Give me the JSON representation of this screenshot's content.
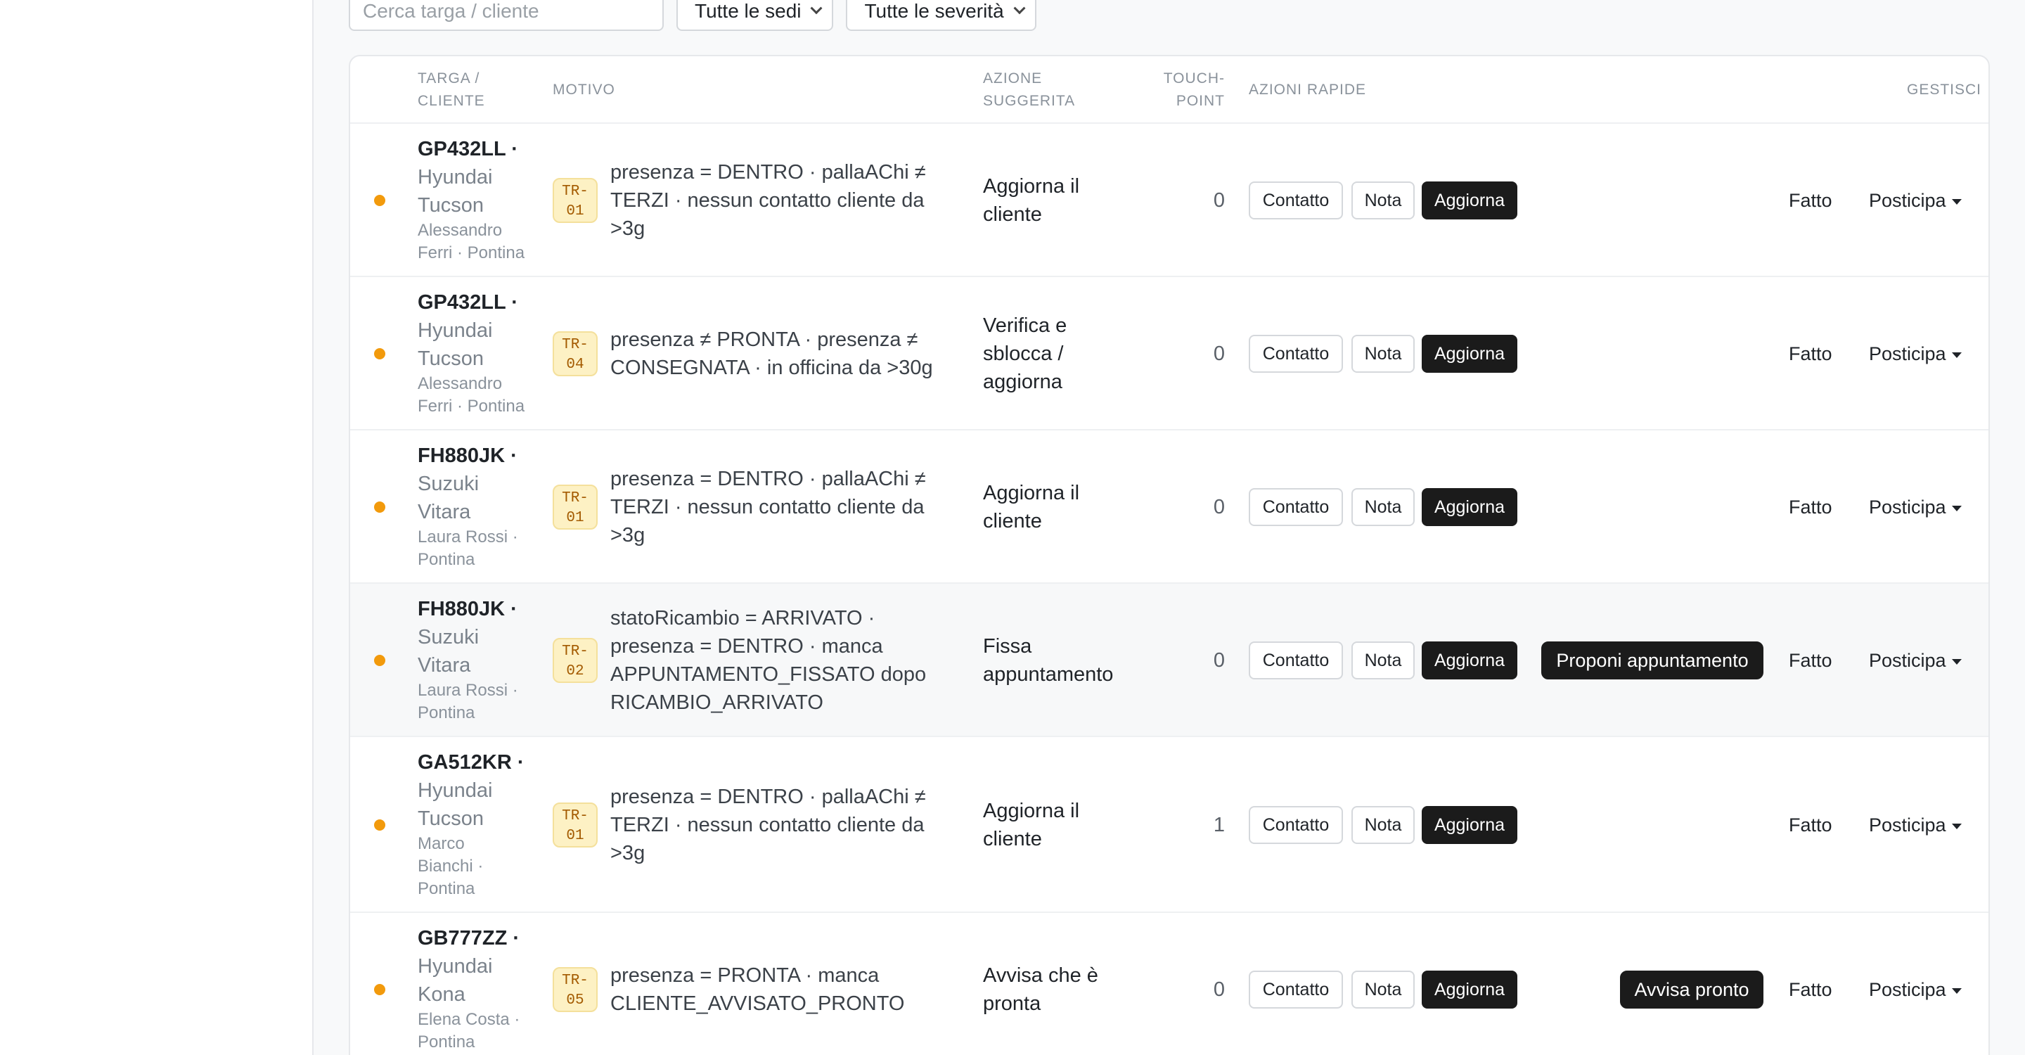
{
  "filters": {
    "search_placeholder": "Cerca targa / cliente",
    "sede_select": "Tutte le sedi",
    "severita_select": "Tutte le severità"
  },
  "table": {
    "headers": {
      "targa_line1": "TARGA /",
      "targa_line2": "CLIENTE",
      "motivo": "MOTIVO",
      "azione_line1": "AZIONE",
      "azione_line2": "SUGGERITA",
      "touch_line1": "TOUCH-",
      "touch_line2": "POINT",
      "azioni_rapide": "AZIONI RAPIDE",
      "gestisci": "GESTISCI"
    },
    "buttons": {
      "contatto": "Contatto",
      "nota": "Nota",
      "aggiorna": "Aggiorna",
      "fatto": "Fatto",
      "posticipa": "Posticipa"
    },
    "rows": [
      {
        "plate": "GP432LL ·",
        "model1": "Hyundai",
        "model2": "Tucson",
        "owner1": "Alessandro",
        "owner2": "Ferri · Pontina",
        "code1": "TR-",
        "code2": "01",
        "motivo1": "presenza = DENTRO · pallaAChi ≠",
        "motivo2": "TERZI · nessun contatto cliente da",
        "motivo3": ">3g",
        "azione1": "Aggiorna il",
        "azione2": "cliente",
        "touchpoint": "0"
      },
      {
        "plate": "GP432LL ·",
        "model1": "Hyundai",
        "model2": "Tucson",
        "owner1": "Alessandro",
        "owner2": "Ferri · Pontina",
        "code1": "TR-",
        "code2": "04",
        "motivo1": "presenza ≠ PRONTA · presenza ≠",
        "motivo2": "CONSEGNATA · in officina da >30g",
        "azione1": "Verifica e",
        "azione2": "sblocca /",
        "azione3": "aggiorna",
        "touchpoint": "0"
      },
      {
        "plate": "FH880JK ·",
        "model1": "Suzuki",
        "model2": "Vitara",
        "owner1": "Laura Rossi ·",
        "owner2": "Pontina",
        "code1": "TR-",
        "code2": "01",
        "motivo1": "presenza = DENTRO · pallaAChi ≠",
        "motivo2": "TERZI · nessun contatto cliente da",
        "motivo3": ">3g",
        "azione1": "Aggiorna il",
        "azione2": "cliente",
        "touchpoint": "0"
      },
      {
        "plate": "FH880JK ·",
        "model1": "Suzuki",
        "model2": "Vitara",
        "owner1": "Laura Rossi ·",
        "owner2": "Pontina",
        "code1": "TR-",
        "code2": "02",
        "motivo1": "statoRicambio = ARRIVATO ·",
        "motivo2": "presenza = DENTRO · manca",
        "motivo3": "APPUNTAMENTO_FISSATO dopo",
        "motivo4": "RICAMBIO_ARRIVATO",
        "azione1": "Fissa",
        "azione2": "appuntamento",
        "touchpoint": "0",
        "extra_action": "Proponi appuntamento"
      },
      {
        "plate": "GA512KR ·",
        "model1": "Hyundai",
        "model2": "Tucson",
        "owner1": "Marco",
        "owner2": "Bianchi ·",
        "owner3": "Pontina",
        "code1": "TR-",
        "code2": "01",
        "motivo1": "presenza = DENTRO · pallaAChi ≠",
        "motivo2": "TERZI · nessun contatto cliente da",
        "motivo3": ">3g",
        "azione1": "Aggiorna il",
        "azione2": "cliente",
        "touchpoint": "1"
      },
      {
        "plate": "GB777ZZ ·",
        "model1": "Hyundai",
        "model2": "Kona",
        "owner1": "Elena Costa ·",
        "owner2": "Pontina",
        "code1": "TR-",
        "code2": "05",
        "motivo1": "presenza = PRONTA · manca",
        "motivo2": "CLIENTE_AVVISATO_PRONTO",
        "azione1": "Avvisa che è",
        "azione2": "pronta",
        "touchpoint": "0",
        "extra_action": "Avvisa pronto"
      }
    ]
  },
  "colors": {
    "severity_dot": "#f29a0c",
    "badge_bg": "#fdf1c4",
    "primary_button": "#1b1b1b"
  }
}
